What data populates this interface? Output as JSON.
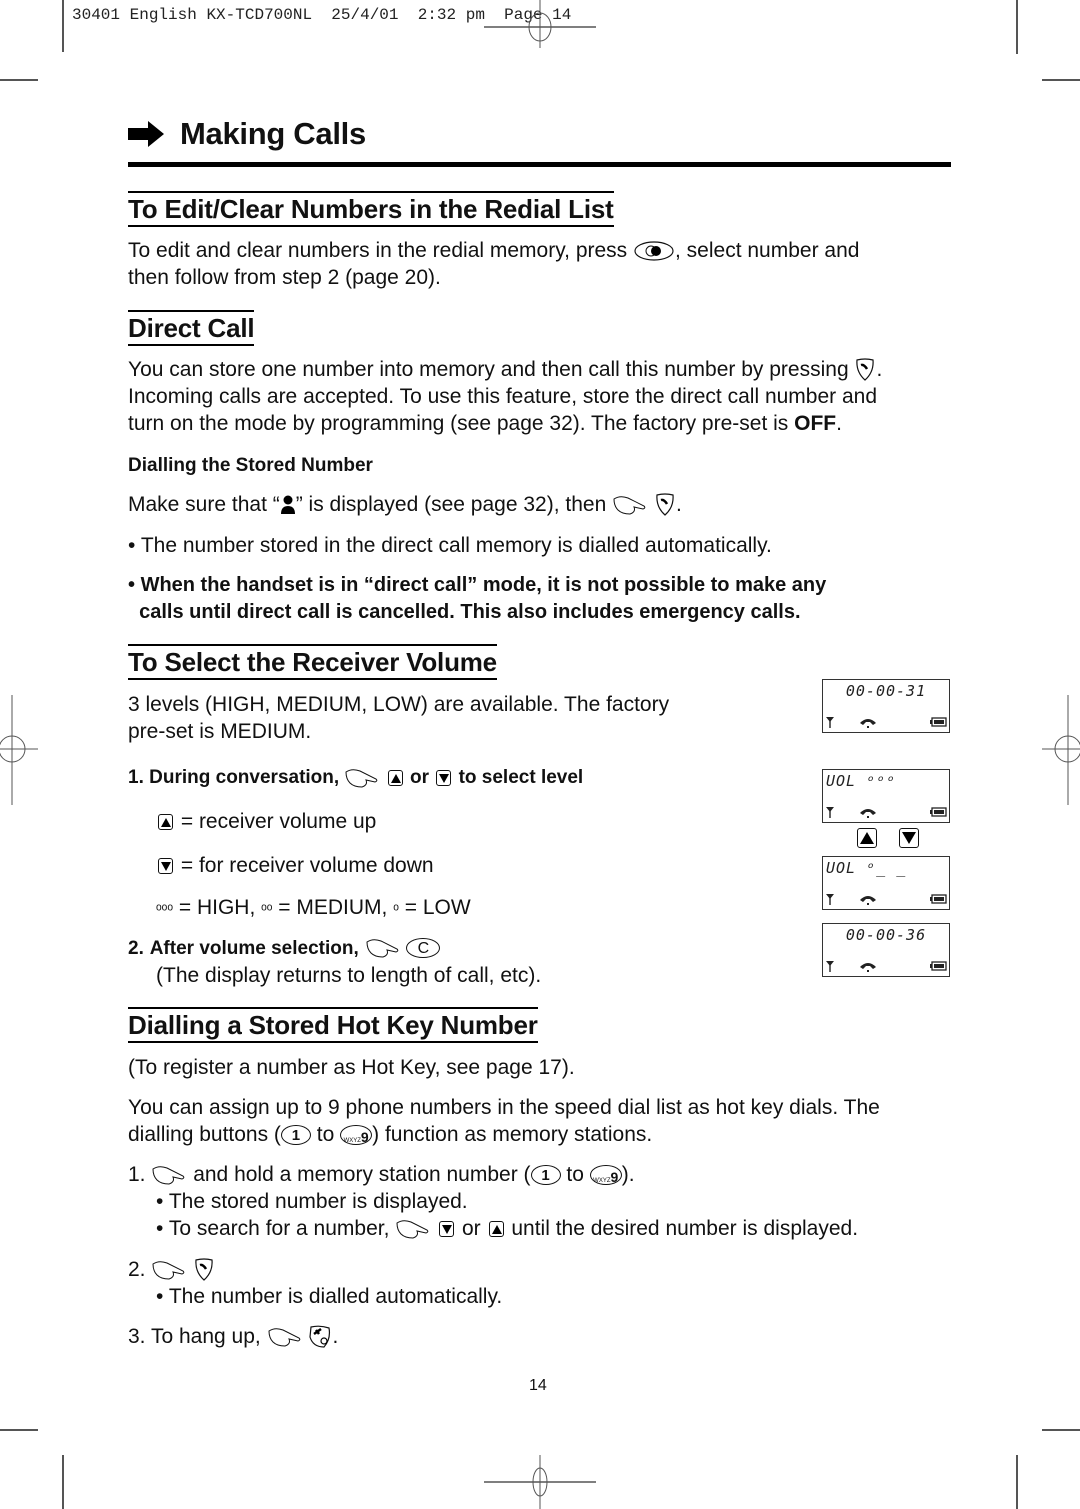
{
  "slug": {
    "job": "30401",
    "language": "English",
    "model": "KX-TCD700NL",
    "date": "25/4/01",
    "time": "2:32 pm",
    "page_label": "Page 14"
  },
  "page_title": "Making Calls",
  "sections": {
    "edit_clear": {
      "heading": "To Edit/Clear Numbers in the Redial List",
      "line1_a": "To edit and clear numbers in the redial memory, press",
      "line1_b": ", select number and",
      "line2": "then follow from step 2 (page 20)."
    },
    "direct_call": {
      "heading": "Direct Call",
      "line1_a": "You can store one number into memory and then call this number by pressing",
      "line1_b": ".",
      "line2": "Incoming calls are accepted. To use this feature, store the direct call number and",
      "line3_a": "turn on the mode by programming (see page 32). The factory pre-set is ",
      "line3_bold": "OFF",
      "line3_b": ".",
      "subheading": "Dialling the Stored Number",
      "make_sure_a": "Make sure that “",
      "make_sure_b": "” is displayed (see page 32), then",
      "make_sure_c": ".",
      "bullet1": "The number stored in the direct call memory is dialled automatically.",
      "warning_line1": "When the handset is in “direct call” mode, it is not possible to make any",
      "warning_line2": "calls until direct call is cancelled. This also includes emergency calls."
    },
    "receiver_volume": {
      "heading": "To Select the Receiver Volume",
      "line1": "3 levels (HIGH, MEDIUM, LOW) are available. The factory",
      "line2": "pre-set is MEDIUM.",
      "step1_num": "1.",
      "step1_a": "During conversation,",
      "step1_or": "or",
      "step1_b": "to select level",
      "up_desc": "= receiver volume up",
      "down_desc": "= for receiver volume down",
      "levels": {
        "high_symbol": "ᵒᵒᵒ",
        "high": "= HIGH,",
        "medium_symbol": "ᵒᵒ",
        "medium": "= MEDIUM,",
        "low_symbol": "ᵒ",
        "low": "= LOW"
      },
      "step2_num": "2.",
      "step2_a": "After volume selection,",
      "step2_key": "C",
      "step2_note": "(The display returns to length of call, etc).",
      "lcd_screens": [
        {
          "text": "00-00-31",
          "align": "center"
        },
        {
          "text": "UOL ᵒᵒᵒ",
          "align": "left"
        },
        {
          "text": "UOL ᵒ_ _",
          "align": "left"
        },
        {
          "text": "00-00-36",
          "align": "center"
        }
      ]
    },
    "hot_key": {
      "heading": "Dialling a Stored Hot Key Number",
      "note": "(To register a number as Hot Key, see page 17).",
      "line1": "You can assign up to 9 phone numbers in the speed dial list as hot key dials. The",
      "line2_a": "dialling buttons (",
      "line2_to": "to",
      "line2_b": ") function as memory stations.",
      "key_1": "1",
      "key_9_letters": "WXYZ",
      "key_9": "9",
      "step1_num": "1.",
      "step1_a": "and hold a memory station number (",
      "step1_to": "to",
      "step1_b": ").",
      "step1_bullet1": "The stored number is displayed.",
      "step1_bullet2_a": "To search for a number,",
      "step1_bullet2_or": "or",
      "step1_bullet2_b": "until the desired number is displayed.",
      "step2_num": "2.",
      "step2_bullet": "The number is dialled automatically.",
      "step3_num": "3.",
      "step3_a": "To hang up,",
      "step3_b": "."
    }
  },
  "page_number": "14"
}
